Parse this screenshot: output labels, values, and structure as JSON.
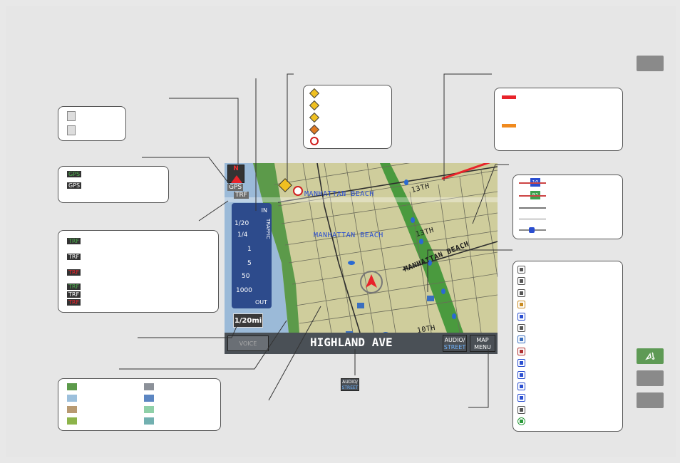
{
  "map": {
    "place_labels": [
      "MANHATTAN BEACH",
      "MANHATTAN BEACH",
      "MANHATTAN BEACH"
    ],
    "street_labels": [
      "13TH",
      "13TH",
      "10TH"
    ],
    "current_street": "HIGHLAND AVE",
    "orientation_button": "N",
    "gps_indicator": "GPS",
    "traffic_indicator": "TRF",
    "scale_in": "IN",
    "scale_out": "OUT",
    "scale_values": [
      "1/20",
      "1/4",
      "1",
      "5",
      "50",
      "1000"
    ],
    "traffic_label": "TRAFFIC",
    "scale_readout": "1/20mi",
    "voice_button": "VOICE",
    "audio_button": [
      "AUDIO/",
      "STREET"
    ],
    "map_menu_button": [
      "MAP",
      "MENU"
    ],
    "partial_scale": "1/",
    "partial_vo": "VO"
  },
  "legends": {
    "gps_status": [
      "GPS",
      "GPS"
    ],
    "traffic_status": [
      "TRF",
      "TRF",
      "TRF",
      "TRF",
      "TRF",
      "TRF"
    ],
    "freeway_shields": [
      "10",
      "91"
    ],
    "audio_icon": [
      "AUDIO/",
      "STREET"
    ]
  },
  "colors": {
    "land": "#cfcd9c",
    "water": "#9bbad8",
    "park": "#5c9a4a",
    "freeway_green": "#3ea04e",
    "traffic_red": "#e8232a",
    "traffic_orange": "#f08a1e",
    "swatches": [
      "#5c9a4a",
      "#8c9199",
      "#9cc0dc",
      "#5c86c2",
      "#b89a72",
      "#8fd0a8",
      "#8db44a",
      "#72b0b0"
    ]
  },
  "icons": [
    "north-up-icon",
    "heading-up-icon",
    "acura-dealer-icon",
    "honda-dealer-icon",
    "atm-icon",
    "gas-station-icon",
    "parking-icon",
    "bank-icon",
    "grocery-icon",
    "hotel-icon",
    "restaurant-icon",
    "phone-icon",
    "hospital-icon",
    "train-icon",
    "school-icon",
    "info-icon",
    "nav-side-icon"
  ]
}
